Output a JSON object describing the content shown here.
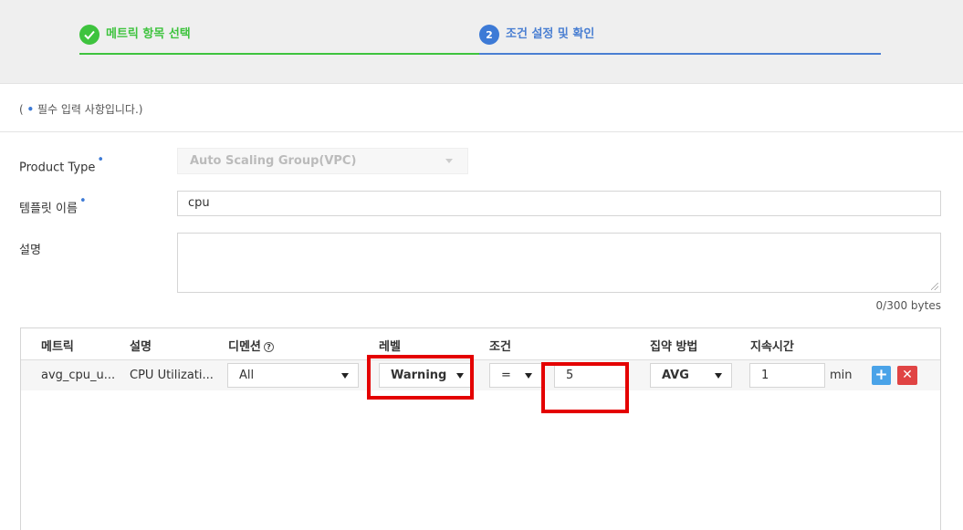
{
  "stepper": {
    "step1": {
      "label": "메트릭 항목 선택",
      "state": "done",
      "icon": "check-icon",
      "color": "#3ec33e"
    },
    "step2": {
      "number": "2",
      "label": "조건 설정 및 확인",
      "state": "active",
      "color": "#4a7fd2"
    }
  },
  "required_note": {
    "prefix": "( ",
    "dot": "•",
    "text": " 필수 입력 사항입니다.)"
  },
  "form": {
    "product_type": {
      "label": "Product Type",
      "required_dot": "•",
      "value": "Auto Scaling Group(VPC)",
      "disabled": true
    },
    "template_name": {
      "label": "템플릿 이름",
      "required_dot": "•",
      "value": "cpu"
    },
    "description": {
      "label": "설명",
      "value": "",
      "byte_counter": "0/300 bytes"
    }
  },
  "metric_table": {
    "headers": {
      "metric": "메트릭",
      "desc": "설명",
      "dimension": "디멘션",
      "dimension_help": "?",
      "level": "레벨",
      "condition": "조건",
      "aggregation": "집약 방법",
      "duration": "지속시간"
    },
    "rows": [
      {
        "metric": "avg_cpu_u...",
        "desc": "CPU Utilizati...",
        "dimension": "All",
        "level": "Warning",
        "operator": "=",
        "threshold": "5",
        "aggregation": "AVG",
        "duration": "1",
        "duration_unit": "min",
        "add_label": "+",
        "delete_label": "✕"
      }
    ]
  },
  "highlights": [
    "level-select",
    "threshold-input"
  ],
  "colors": {
    "accent_green": "#3ec33e",
    "accent_blue": "#3d7ad6",
    "highlight_red": "#e40000",
    "add_button": "#4aa3e8",
    "delete_button": "#e04444"
  }
}
